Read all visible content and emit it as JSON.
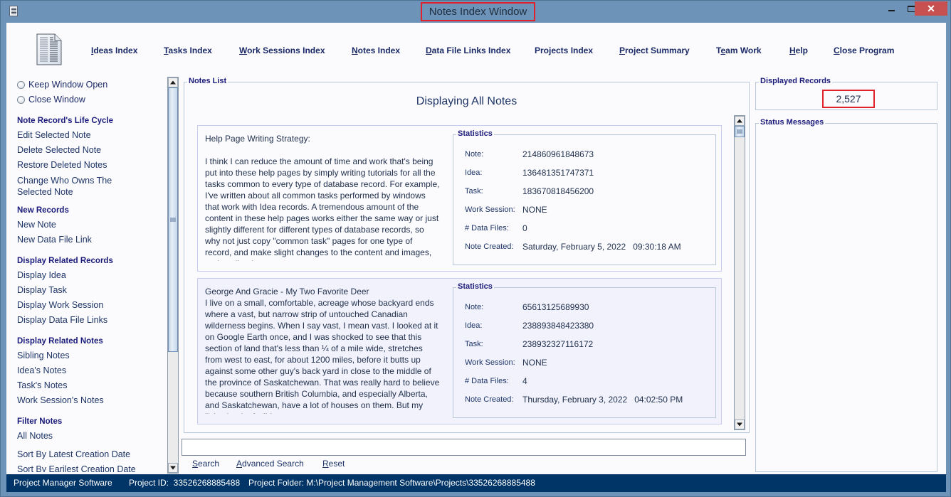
{
  "window": {
    "title": "Notes Index Window",
    "controls": {
      "minimize": "minimize",
      "maximize": "maximize",
      "close": "✕"
    }
  },
  "nav": [
    {
      "label": "Ideas Index",
      "mnemonic": "I"
    },
    {
      "label": "Tasks Index",
      "mnemonic": "T"
    },
    {
      "label": "Work Sessions Index",
      "mnemonic": "W"
    },
    {
      "label": "Notes Index",
      "mnemonic": "N"
    },
    {
      "label": "Data File Links Index",
      "mnemonic": "D"
    },
    {
      "label": "Projects Index",
      "mnemonic": ""
    },
    {
      "label": "Project Summary",
      "mnemonic": "P"
    },
    {
      "label": "Team Work",
      "mnemonic": "e"
    },
    {
      "label": "Help",
      "mnemonic": "H"
    },
    {
      "label": "Close Program",
      "mnemonic": "C"
    }
  ],
  "sidebar": {
    "radios": [
      {
        "label": "Keep Window Open",
        "checked": false
      },
      {
        "label": "Close Window",
        "checked": false
      }
    ],
    "sections": [
      {
        "heading": "Note Record's Life Cycle",
        "items": [
          "Edit Selected Note",
          "Delete Selected Note",
          "Restore Deleted Notes",
          "Change Who Owns The Selected Note"
        ]
      },
      {
        "heading": "New Records",
        "items": [
          "New Note",
          "New Data File Link"
        ]
      },
      {
        "heading": "Display Related Records",
        "items": [
          "Display Idea",
          "Display Task",
          "Display Work Session",
          "Display Data File Links"
        ]
      },
      {
        "heading": "Display Related Notes",
        "items": [
          "Sibling Notes",
          "Idea's Notes",
          "Task's Notes",
          "Work Session's Notes"
        ]
      },
      {
        "heading": "Filter Notes",
        "items": [
          "All Notes",
          "Sort By Latest Creation Date",
          "Sort By Earilest Creation Date"
        ]
      }
    ]
  },
  "notes_list": {
    "title": "Notes List",
    "heading": "Displaying All Notes",
    "stats_title": "Statistics",
    "stat_labels": [
      "Note:",
      "Idea:",
      "Task:",
      "Work Session:",
      "# Data Files:",
      "Note Created:"
    ],
    "notes": [
      {
        "text": "Help Page Writing Strategy:\n\nI think I can reduce the amount of time and work that's being put into these help pages by simply writing tutorials for all the tasks common to every type of database record. For example, I've written about all common tasks performed by windows that work with Idea records. A tremendous amount of the content in these help pages works either the same way or just slightly different for different types of database records, so why not just copy \"common task\" pages for one type of record, and make slight changes to the content and images, to describe that",
        "stats": [
          "214860961848673",
          "136481351747371",
          "183670818456200",
          "NONE",
          "0",
          "Saturday, February 5, 2022   09:30:18 AM"
        ]
      },
      {
        "text": "George And Gracie - My Two Favorite Deer\nI live on a small, comfortable, acreage whose backyard ends where a vast, but narrow strip of untouched Canadian wilderness begins. When I say vast, I mean vast. I looked at it on Google Earth once, and I was shocked to see that this section of land that's less than ¼ of a mile wide, stretches from west to east, for about 1200 miles, before it butts up against some other guy's back yard in close to the middle of the province of Saskatchewan. That was really hard to believe because southern British Columbia, and especially Alberta, and Saskatchewan, have a lot of houses on them. But my little chunk of wilderness manages to",
        "stats": [
          "65613125689930",
          "238893848423380",
          "238932327116172",
          "NONE",
          "4",
          "Thursday, February 3, 2022   04:02:50 PM"
        ]
      }
    ]
  },
  "search": {
    "value": "",
    "placeholder": "",
    "buttons": [
      {
        "label": "Search",
        "mnemonic": "S"
      },
      {
        "label": "Advanced Search",
        "mnemonic": "A"
      },
      {
        "label": "Reset",
        "mnemonic": "R"
      }
    ]
  },
  "right_panel": {
    "records_title": "Displayed Records",
    "records_count": "2,527",
    "status_title": "Status Messages",
    "status_messages": ""
  },
  "statusbar": {
    "app_name": "Project Manager Software",
    "project_id": "Project ID:  33526268885488",
    "project_folder": "Project Folder: M:\\Project Management Software\\Projects\\33526268885488"
  }
}
